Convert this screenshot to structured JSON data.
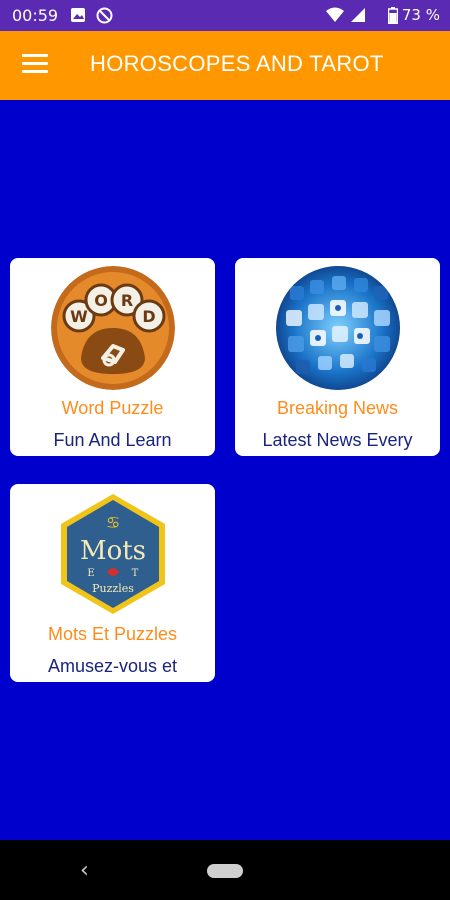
{
  "status_bar": {
    "time": "00:59",
    "battery": "73 %",
    "icons": [
      "image-icon",
      "do-not-disturb-icon",
      "wifi-icon",
      "signal-icon",
      "battery-icon"
    ]
  },
  "app_bar": {
    "title": "HOROSCOPES AND TAROT",
    "menu_icon": "hamburger-menu-icon",
    "color": "#ff9800"
  },
  "background_color": "#0000cc",
  "apps": [
    {
      "title": "Word Puzzle",
      "subtitle": "Fun And Learn",
      "icon": "word-paw-icon",
      "logo_text": "WORD"
    },
    {
      "title": "Breaking News",
      "subtitle": "Latest News Every",
      "icon": "social-media-icons-image"
    },
    {
      "title": "Mots Et Puzzles",
      "subtitle": "Amusez-vous et",
      "icon": "mots-puzzles-icon",
      "logo_text": "Mots",
      "logo_sub": "Puzzles"
    }
  ],
  "nav_bar": {
    "back_icon": "back-chevron-icon",
    "home_icon": "home-pill-icon"
  }
}
